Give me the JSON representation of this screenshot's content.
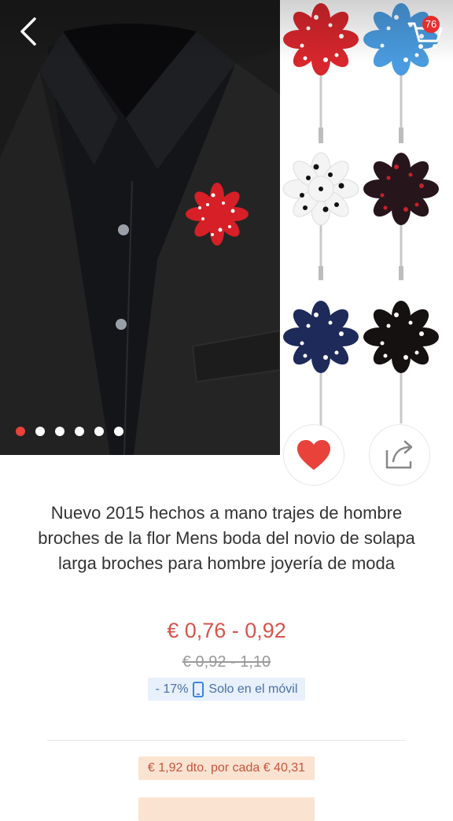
{
  "header": {
    "back_icon": "chevron-left-icon",
    "cart_icon": "cart-icon",
    "cart_count": "76"
  },
  "gallery": {
    "total_images": 6,
    "active_index": 0
  },
  "actions": {
    "favorite_icon": "heart-icon",
    "share_icon": "share-icon"
  },
  "product": {
    "title": "Nuevo 2015 hechos a mano trajes de hombre broches de la flor Mens boda del novio de solapa larga broches para hombre joyería de moda",
    "price": "€ 0,76 - 0,92",
    "original_price": "€ 0,92 - 1,10",
    "discount": "- 17%",
    "mobile_only_label": "Solo en el móvil",
    "coupon": "€ 1,92 dto. por cada € 40,31"
  },
  "colors": {
    "price": "#d9534a",
    "active_dot": "#e8423a",
    "heart": "#e8423a",
    "badge": "#e62e2e"
  }
}
